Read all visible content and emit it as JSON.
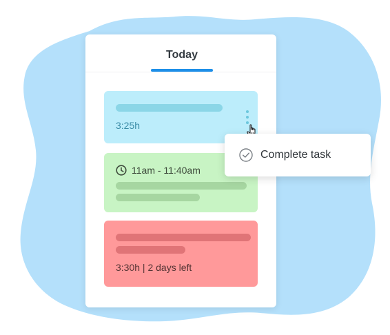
{
  "tabs": {
    "active_label": "Today"
  },
  "tasks": [
    {
      "name": "task-card-blue",
      "time": "3:25h",
      "color": "#bcedfb"
    },
    {
      "name": "task-card-green",
      "time": "11am - 11:40am",
      "color": "#c8f4c4",
      "icon": "clock-icon"
    },
    {
      "name": "task-card-red",
      "time": "3:30h | 2 days left",
      "color": "#ff999a"
    }
  ],
  "context_menu": {
    "items": [
      {
        "label": "Complete task",
        "icon": "check-circle-icon"
      }
    ]
  },
  "colors": {
    "background_blob": "#b4e0fb",
    "accent": "#1e8fe8"
  }
}
